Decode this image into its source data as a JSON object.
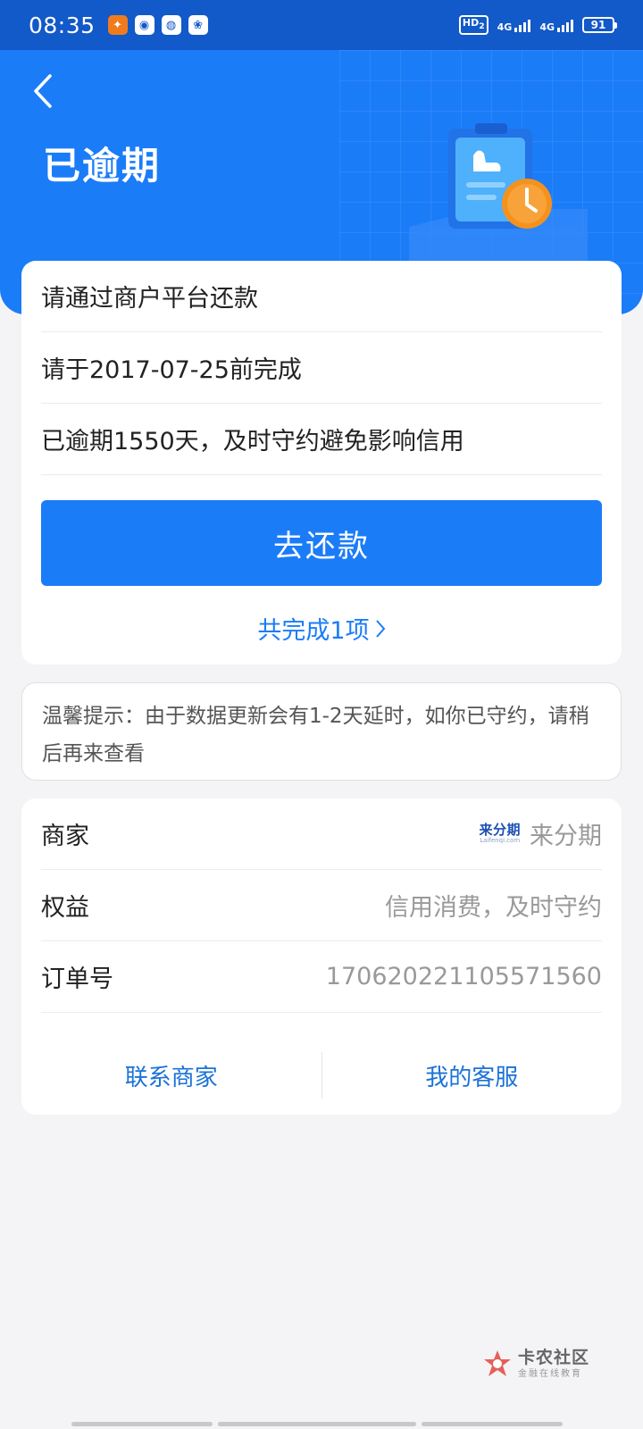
{
  "status_bar": {
    "time": "08:35",
    "hd_label": "HD",
    "hd_sub": "2",
    "network_1": "4G",
    "network_2": "4G",
    "battery": "91",
    "notification_icons": [
      "browser-app-icon",
      "chrome-icon",
      "wechat-icon",
      "baidu-icon"
    ]
  },
  "header": {
    "title": "已逾期",
    "illustration": "overdue-clipboard-clock"
  },
  "main_card": {
    "rows": [
      "请通过商户平台还款",
      "请于2017-07-25前完成",
      "已逾期1550天，及时守约避免影响信用"
    ],
    "repay_button": "去还款",
    "completed_link": "共完成1项"
  },
  "tip": {
    "text": "温馨提示：由于数据更新会有1-2天延时，如你已守约，请稍后再来查看"
  },
  "details": {
    "merchant_label": "商家",
    "merchant_logo_text": "来分期",
    "merchant_logo_sub": "Laifenqi.com",
    "merchant_value": "来分期",
    "benefit_label": "权益",
    "benefit_value": "信用消费，及时守约",
    "order_label": "订单号",
    "order_value": "17062022110557156​0",
    "contact_merchant": "联系商家",
    "my_service": "我的客服"
  },
  "watermark": {
    "title": "卡农社区",
    "subtitle": "金融在线教育"
  },
  "colors": {
    "primary": "#1b7cf8",
    "status_bar": "#1259c9",
    "clock_accent": "#f5921e"
  }
}
